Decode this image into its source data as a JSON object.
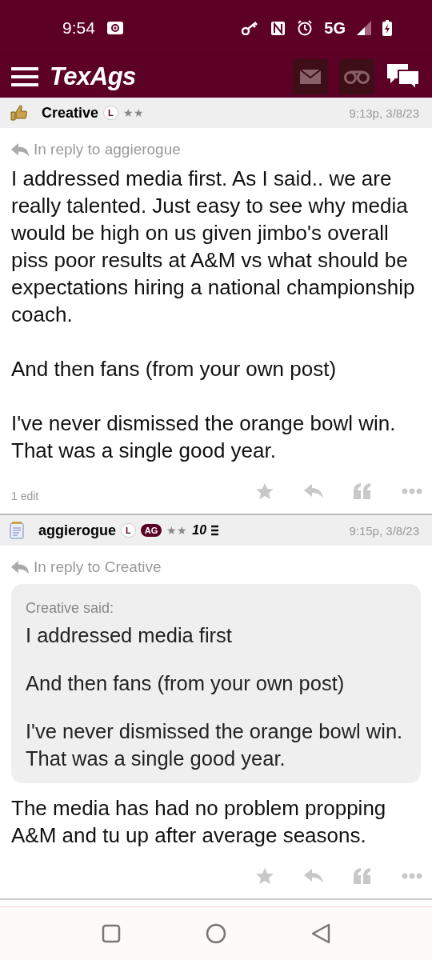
{
  "status_bar": {
    "time": "9:54",
    "network": "5G"
  },
  "header": {
    "logo": "TexAgs"
  },
  "posts": [
    {
      "avatar": {
        "kind": "thumb"
      },
      "author": "Creative",
      "badges": [
        {
          "kind": "outline",
          "text": "L"
        }
      ],
      "stars": "★★",
      "time": "9:13p, 3/8/23",
      "reply_to": "In reply to aggierogue",
      "paragraphs": [
        "I addressed media first. As I said.. we are really talented. Just easy to see why media would be high on us given jimbo's overall piss poor results at A&M vs what should be expectations hiring a national championship coach.",
        "And then fans (from your own post)",
        "I've never dismissed the orange bowl win. That was a single good year."
      ],
      "edits": "1 edit"
    },
    {
      "avatar": {
        "kind": "note"
      },
      "author": "aggierogue",
      "badges": [
        {
          "kind": "outline",
          "text": "L"
        },
        {
          "kind": "filled",
          "text": "AG"
        }
      ],
      "stars": "★★",
      "years": "10",
      "time": "9:15p, 3/8/23",
      "reply_to": "In reply to Creative",
      "quote": {
        "attribution": "Creative said:",
        "paragraphs": [
          "I addressed media first",
          "And then fans (from your own post)",
          "I've never dismissed the orange bowl win. That was a single good year."
        ]
      },
      "paragraphs": [
        "The media has had no problem propping A&M and tu up after average seasons."
      ]
    }
  ]
}
